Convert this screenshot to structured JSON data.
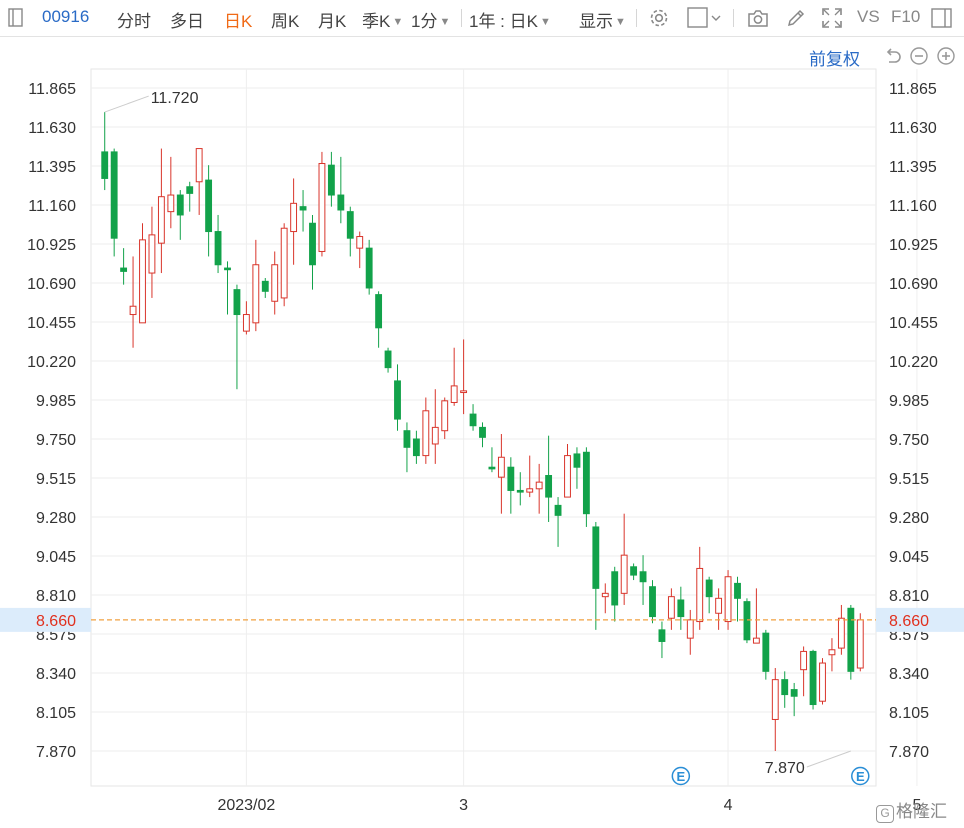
{
  "toolbar": {
    "code": "00916",
    "tabs": [
      "分时",
      "多日",
      "日K",
      "周K",
      "月K"
    ],
    "active_tab": "日K",
    "season": "季K",
    "minute": "1分",
    "range": "1年 : 日K",
    "display": "显示",
    "vs": "VS",
    "f10": "F10"
  },
  "adjust_label": "前复权",
  "current_price_label": "8.660",
  "event_marker": "E",
  "watermark": "格隆汇",
  "colors": {
    "up": "#d9352b",
    "down": "#12a24a",
    "current_line": "#f0a040",
    "current_bg": "#dcecfb",
    "accent": "#f06a16",
    "link": "#2a6bc6"
  },
  "chart_data": {
    "type": "candlestick",
    "y_ticks": [
      "11.865",
      "11.630",
      "11.395",
      "11.160",
      "10.925",
      "10.690",
      "10.455",
      "10.220",
      "9.985",
      "9.750",
      "9.515",
      "9.280",
      "9.045",
      "8.810",
      "8.575",
      "8.340",
      "8.105",
      "7.870"
    ],
    "ylim": [
      7.78,
      11.98
    ],
    "x_ticks": [
      {
        "label": "2023/02",
        "index": 15
      },
      {
        "label": "3",
        "index": 38
      },
      {
        "label": "4",
        "index": 66
      },
      {
        "label": "5",
        "index": 86
      }
    ],
    "high_annotation": {
      "label": "11.720",
      "index": 0,
      "value": 11.72
    },
    "low_annotation": {
      "label": "7.870",
      "index": 79,
      "value": 7.87
    },
    "current_price": 8.66,
    "events": [
      {
        "index": 61,
        "label": "E"
      },
      {
        "index": 80,
        "label": "E"
      }
    ],
    "candles": [
      [
        11.48,
        11.32,
        11.72,
        11.25
      ],
      [
        11.48,
        10.96,
        11.5,
        10.85
      ],
      [
        10.78,
        10.76,
        10.9,
        10.68
      ],
      [
        10.5,
        10.55,
        10.85,
        10.3
      ],
      [
        10.45,
        10.95,
        11.05,
        10.45
      ],
      [
        10.75,
        10.98,
        11.15,
        10.6
      ],
      [
        10.93,
        11.21,
        11.5,
        10.75
      ],
      [
        11.12,
        11.22,
        11.45,
        11.02
      ],
      [
        11.22,
        11.1,
        11.25,
        10.95
      ],
      [
        11.27,
        11.23,
        11.3,
        11.12
      ],
      [
        11.3,
        11.5,
        11.5,
        11.1
      ],
      [
        11.31,
        11.0,
        11.4,
        10.85
      ],
      [
        11.0,
        10.8,
        11.1,
        10.75
      ],
      [
        10.78,
        10.77,
        10.82,
        10.5
      ],
      [
        10.65,
        10.5,
        10.68,
        10.05
      ],
      [
        10.4,
        10.5,
        10.58,
        10.38
      ],
      [
        10.45,
        10.8,
        10.95,
        10.4
      ],
      [
        10.7,
        10.64,
        10.72,
        10.6
      ],
      [
        10.58,
        10.8,
        10.88,
        10.5
      ],
      [
        10.6,
        11.02,
        11.05,
        10.55
      ],
      [
        11.0,
        11.17,
        11.32,
        10.8
      ],
      [
        11.15,
        11.13,
        11.25,
        11.0
      ],
      [
        11.05,
        10.8,
        11.1,
        10.65
      ],
      [
        10.88,
        11.41,
        11.48,
        10.85
      ],
      [
        11.4,
        11.22,
        11.48,
        11.15
      ],
      [
        11.22,
        11.13,
        11.45,
        11.05
      ],
      [
        11.12,
        10.96,
        11.15,
        10.85
      ],
      [
        10.9,
        10.97,
        11.0,
        10.78
      ],
      [
        10.9,
        10.66,
        10.95,
        10.62
      ],
      [
        10.62,
        10.42,
        10.64,
        10.3
      ],
      [
        10.28,
        10.18,
        10.3,
        10.15
      ],
      [
        10.1,
        9.87,
        10.2,
        9.8
      ],
      [
        9.8,
        9.7,
        9.85,
        9.55
      ],
      [
        9.75,
        9.65,
        9.8,
        9.6
      ],
      [
        9.65,
        9.92,
        10.0,
        9.6
      ],
      [
        9.72,
        9.82,
        10.05,
        9.6
      ],
      [
        9.8,
        9.98,
        10.0,
        9.75
      ],
      [
        9.97,
        10.07,
        10.3,
        9.95
      ],
      [
        10.03,
        10.04,
        10.35,
        9.9
      ],
      [
        9.9,
        9.83,
        9.96,
        9.8
      ],
      [
        9.82,
        9.76,
        9.85,
        9.7
      ],
      [
        9.58,
        9.57,
        9.7,
        9.55
      ],
      [
        9.52,
        9.64,
        9.78,
        9.3
      ],
      [
        9.58,
        9.44,
        9.64,
        9.3
      ],
      [
        9.44,
        9.43,
        9.55,
        9.35
      ],
      [
        9.43,
        9.45,
        9.65,
        9.4
      ],
      [
        9.45,
        9.49,
        9.6,
        9.3
      ],
      [
        9.53,
        9.4,
        9.77,
        9.25
      ],
      [
        9.35,
        9.29,
        9.4,
        9.1
      ],
      [
        9.4,
        9.65,
        9.72,
        9.4
      ],
      [
        9.66,
        9.58,
        9.7,
        9.45
      ],
      [
        9.67,
        9.3,
        9.7,
        9.22
      ],
      [
        9.22,
        8.85,
        9.25,
        8.6
      ],
      [
        8.8,
        8.82,
        8.88,
        8.7
      ],
      [
        8.95,
        8.75,
        8.98,
        8.65
      ],
      [
        8.82,
        9.05,
        9.3,
        8.75
      ],
      [
        8.98,
        8.93,
        9.0,
        8.9
      ],
      [
        8.95,
        8.89,
        9.05,
        8.75
      ],
      [
        8.86,
        8.68,
        8.9,
        8.64
      ],
      [
        8.6,
        8.53,
        8.65,
        8.43
      ],
      [
        8.67,
        8.8,
        8.85,
        8.6
      ],
      [
        8.78,
        8.68,
        8.86,
        8.6
      ],
      [
        8.55,
        8.66,
        8.72,
        8.45
      ],
      [
        8.65,
        8.97,
        9.1,
        8.6
      ],
      [
        8.9,
        8.8,
        8.92,
        8.7
      ],
      [
        8.7,
        8.79,
        8.85,
        8.6
      ],
      [
        8.65,
        8.92,
        8.96,
        8.6
      ],
      [
        8.88,
        8.79,
        8.92,
        8.65
      ],
      [
        8.77,
        8.54,
        8.79,
        8.52
      ],
      [
        8.52,
        8.55,
        8.85,
        8.52
      ],
      [
        8.58,
        8.35,
        8.6,
        8.3
      ],
      [
        8.06,
        8.3,
        8.37,
        7.87
      ],
      [
        8.3,
        8.21,
        8.35,
        8.13
      ],
      [
        8.24,
        8.2,
        8.28,
        8.08
      ],
      [
        8.36,
        8.47,
        8.5,
        8.2
      ],
      [
        8.47,
        8.15,
        8.48,
        8.12
      ],
      [
        8.17,
        8.4,
        8.43,
        8.15
      ],
      [
        8.45,
        8.48,
        8.55,
        8.35
      ],
      [
        8.49,
        8.67,
        8.75,
        8.45
      ],
      [
        8.73,
        8.35,
        8.75,
        8.3
      ],
      [
        8.37,
        8.66,
        8.7,
        8.35
      ]
    ]
  }
}
